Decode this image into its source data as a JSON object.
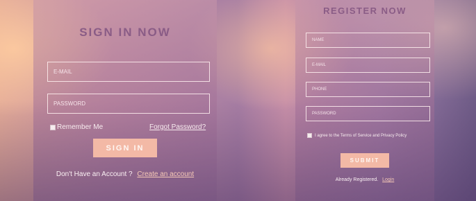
{
  "signin": {
    "title": "SIGN IN NOW",
    "email_placeholder": "E-MAIL",
    "password_placeholder": "PASSWORD",
    "remember_label": "Remember Me",
    "forgot_link": "Forgot Password?",
    "button_label": "SIGN IN",
    "no_account_text": "Don't Have an Account ?",
    "create_link": "Create an account"
  },
  "register": {
    "title": "REGISTER NOW",
    "name_placeholder": "NAME",
    "email_placeholder": "E-MAIL",
    "phone_placeholder": "PHONE",
    "password_placeholder": "PASSWORD",
    "terms_label": "I agree to the Terms of Service and Privacy Policy",
    "button_label": "SUBMIT",
    "already_text": "Already Registered.",
    "login_link": "Login"
  },
  "colors": {
    "title": "#8a5c86",
    "button": "#f3b9a6"
  }
}
